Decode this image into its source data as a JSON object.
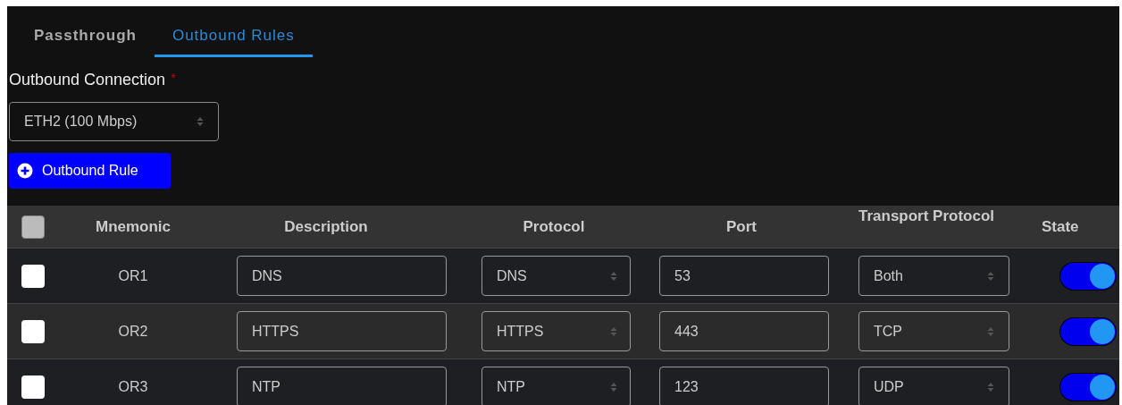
{
  "tabs": [
    {
      "label": "Passthrough",
      "selected": false
    },
    {
      "label": "Outbound Rules",
      "selected": true
    }
  ],
  "outbound_connection": {
    "label": "Outbound Connection",
    "required_mark": "*",
    "value": "ETH2 (100 Mbps)"
  },
  "add_button": {
    "label": "Outbound Rule"
  },
  "table": {
    "select_all": {
      "checked": false,
      "disabled": true
    },
    "columns": [
      "Mnemonic",
      "Description",
      "Protocol",
      "Port",
      "Transport Protocol",
      "State"
    ],
    "rows": [
      {
        "checked": false,
        "mnemonic": "OR1",
        "description": "DNS",
        "protocol": "DNS",
        "port": "53",
        "transport": "Both",
        "on": true
      },
      {
        "checked": false,
        "mnemonic": "OR2",
        "description": "HTTPS",
        "protocol": "HTTPS",
        "port": "443",
        "transport": "TCP",
        "on": true
      },
      {
        "checked": false,
        "mnemonic": "OR3",
        "description": "NTP",
        "protocol": "NTP",
        "port": "123",
        "transport": "UDP",
        "on": true
      }
    ]
  }
}
